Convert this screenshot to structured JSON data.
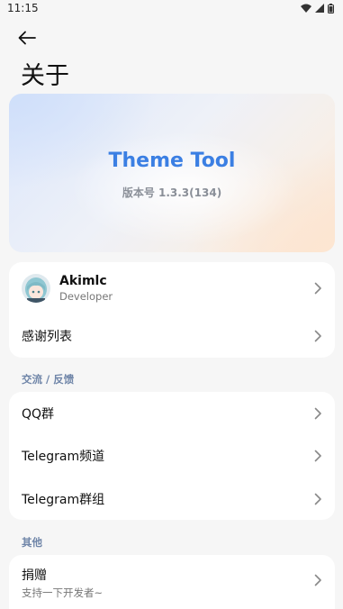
{
  "status_bar": {
    "time": "11:15"
  },
  "header": {
    "title": "关于"
  },
  "hero": {
    "app_name": "Theme Tool",
    "version": "版本号 1.3.3(134)"
  },
  "developer": {
    "name": "Akimlc",
    "role": "Developer",
    "thanks_label": "感谢列表"
  },
  "feedback": {
    "section_title": "交流 / 反馈",
    "items": [
      {
        "label": "QQ群"
      },
      {
        "label": "Telegram频道"
      },
      {
        "label": "Telegram群组"
      }
    ]
  },
  "other": {
    "section_title": "其他",
    "donate_label": "捐赠",
    "donate_sub": "支持一下开发者~"
  },
  "colors": {
    "accent": "#3b7fe3",
    "section": "#6f85a8",
    "background": "#f6f6f6"
  }
}
